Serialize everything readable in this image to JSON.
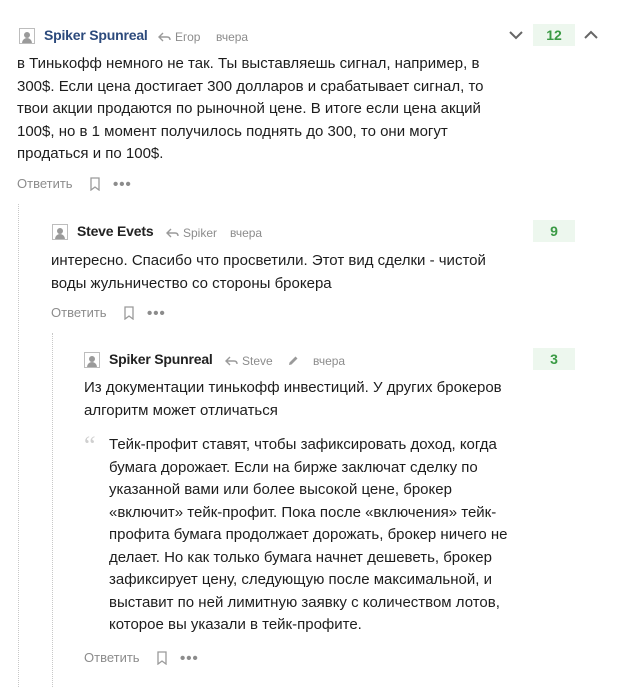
{
  "comment1": {
    "author": "Spiker Spunreal",
    "reply_to": "Егор",
    "time": "вчера",
    "score": "12",
    "lines": [
      "в Тинькофф немного не так. Ты выставляешь сигнал, например, в",
      "300$. Если цена достигает 300 долларов и срабатывает сигнал, то",
      "твои акции продаются по рыночной цене. В итоге если цена акций",
      "100$, но в 1 момент получилось поднять до 300, то они могут",
      "продаться и по 100$."
    ],
    "reply_label": "Ответить",
    "more": "•••"
  },
  "comment2": {
    "author": "Steve Evets",
    "reply_to": "Spiker",
    "time": "вчера",
    "score": "9",
    "lines": [
      "интересно. Спасибо что просветили. Этот вид сделки - чистой",
      "воды жульничество со стороны брокера"
    ],
    "reply_label": "Ответить",
    "more": "•••"
  },
  "comment3": {
    "author": "Spiker Spunreal",
    "reply_to": "Steve",
    "time": "вчера",
    "score": "3",
    "lines": [
      "Из документации тинькофф инвестиций. У других брокеров",
      "алгоритм может отличаться"
    ],
    "quote_lines": [
      "Тейк-профит ставят, чтобы зафиксировать доход, когда",
      "бумага дорожает. Если на бирже заключат сделку по",
      "указанной вами или более высокой цене, брокер",
      "«включит» тейк-профит. Пока после «включения» тейк-",
      "профита бумага продолжает дорожать, брокер ничего не",
      "делает. Но как только бумага начнет дешеветь, брокер",
      "зафиксирует цену, следующую после максимальной, и",
      "выставит по ней лимитную заявку с количеством лотов,",
      "которое вы указали в тейк-профите."
    ],
    "quote_mark": "“",
    "reply_label": "Ответить",
    "more": "•••"
  },
  "colors": {
    "author_link": "#2c4a7c",
    "score_bg": "#edf7ee",
    "score_text": "#3a9a44",
    "muted": "#8c8c8c"
  },
  "icons": [
    "avatar-placeholder-icon",
    "reply-arrow-icon",
    "edit-pencil-icon",
    "bookmark-icon",
    "more-dots-icon",
    "chevron-down-icon",
    "chevron-up-icon"
  ]
}
